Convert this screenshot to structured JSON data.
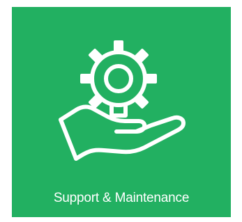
{
  "tile": {
    "label": "Support & Maintenance",
    "icon": "gear-in-hand-icon",
    "background_color": "#22b061",
    "foreground_color": "#ffffff"
  }
}
